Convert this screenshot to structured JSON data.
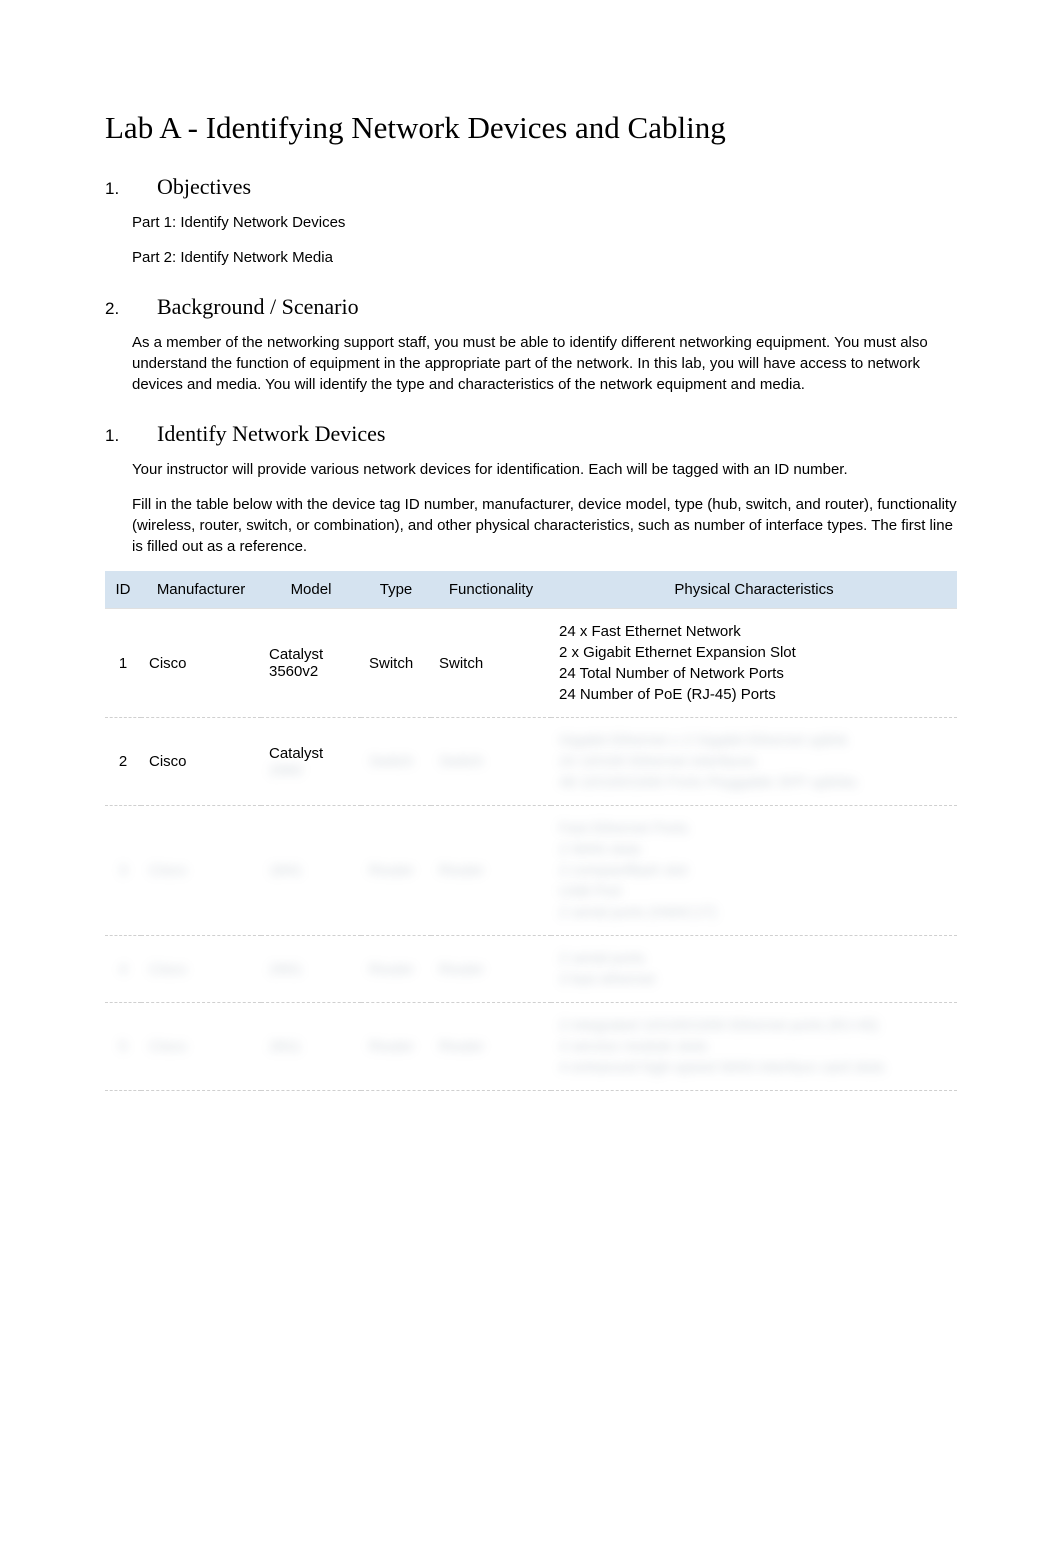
{
  "title": "Lab A - Identifying Network Devices and Cabling",
  "sections": {
    "objectives": {
      "num": "1.",
      "heading": "Objectives",
      "items": [
        "Part 1: Identify Network Devices",
        "Part 2: Identify Network Media"
      ]
    },
    "background": {
      "num": "2.",
      "heading": "Background / Scenario",
      "paragraph": "As a member of the networking support staff, you must be able to identify different networking equipment. You must also understand the function of equipment in the appropriate part of the network. In this lab, you will have access to network devices and media. You will identify the type and characteristics of the network equipment and media."
    },
    "identify": {
      "num": "1.",
      "heading": "Identify Network Devices",
      "p1": "Your instructor will provide various network devices for identification. Each will be tagged with an ID number.",
      "p2": "Fill in the table below with the device tag ID number, manufacturer, device model, type (hub, switch, and router), functionality (wireless, router, switch, or combination), and other physical characteristics, such as number of interface types. The first line is filled out as a reference."
    }
  },
  "table": {
    "headers": {
      "id": "ID",
      "manufacturer": "Manufacturer",
      "model": "Model",
      "type": "Type",
      "functionality": "Functionality",
      "characteristics": "Physical Characteristics"
    },
    "rows": [
      {
        "id": "1",
        "manufacturer": "Cisco",
        "model": "Catalyst 3560v2",
        "type": "Switch",
        "functionality": "Switch",
        "characteristics": [
          "24 x Fast Ethernet Network",
          "2 x Gigabit Ethernet Expansion Slot",
          "24 Total Number of Network Ports",
          "24 Number of PoE (RJ-45) Ports"
        ],
        "hidden": false
      },
      {
        "id": "2",
        "manufacturer": "Cisco",
        "model": "Catalyst",
        "model_hidden": "2960",
        "type": "Switch",
        "functionality": "Switch",
        "characteristics": [
          "Gigabit Ethernet x 2 Gigabit Ethernet uplink",
          "24 10/100 Ethernet interfaces",
          "48 10/100/1000 Ports Pluggable SFP uplinks"
        ],
        "hidden": "partial"
      },
      {
        "id": "3",
        "manufacturer": "Cisco",
        "model": "1841",
        "type": "Router",
        "functionality": "Router",
        "characteristics": [
          "Fast Ethernet Ports",
          "2 WAN slots",
          "2 compactflash slot",
          "USB Port",
          "2 serial ports (HWIC1T)"
        ],
        "hidden": true
      },
      {
        "id": "4",
        "manufacturer": "Cisco",
        "model": "2901",
        "type": "Router",
        "functionality": "Router",
        "characteristics": [
          "2 serial ports",
          "3 fast ethernet"
        ],
        "hidden": true
      },
      {
        "id": "5",
        "manufacturer": "Cisco",
        "model": "2811",
        "type": "Router",
        "functionality": "Router",
        "characteristics": [
          "2 integrated 10/100/1000 Ethernet ports (RJ-45)",
          "4 service module slots",
          "4 enhanced high-speed WAN interface card slots"
        ],
        "hidden": true
      }
    ]
  }
}
